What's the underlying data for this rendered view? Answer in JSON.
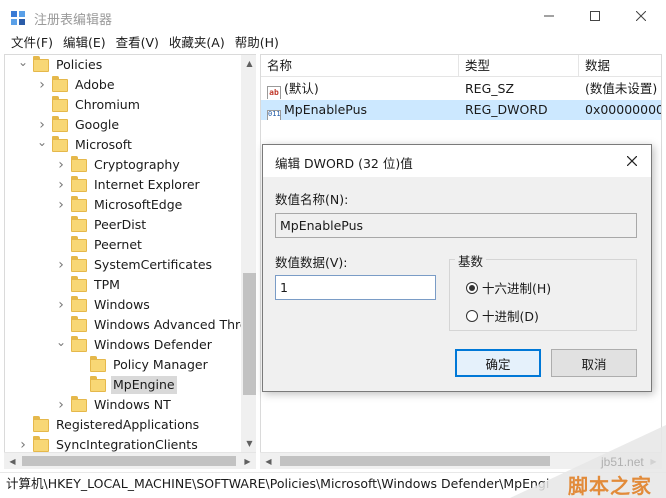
{
  "window": {
    "title": "注册表编辑器",
    "minimize": "—",
    "maximize": "☐",
    "close": "✕"
  },
  "menu": [
    "文件(F)",
    "编辑(E)",
    "查看(V)",
    "收藏夹(A)",
    "帮助(H)"
  ],
  "tree": [
    {
      "label": "Policies",
      "depth": 0,
      "expander": "open"
    },
    {
      "label": "Adobe",
      "depth": 1,
      "expander": "closed"
    },
    {
      "label": "Chromium",
      "depth": 1,
      "expander": "none"
    },
    {
      "label": "Google",
      "depth": 1,
      "expander": "closed"
    },
    {
      "label": "Microsoft",
      "depth": 1,
      "expander": "open"
    },
    {
      "label": "Cryptography",
      "depth": 2,
      "expander": "closed"
    },
    {
      "label": "Internet Explorer",
      "depth": 2,
      "expander": "closed"
    },
    {
      "label": "MicrosoftEdge",
      "depth": 2,
      "expander": "closed"
    },
    {
      "label": "PeerDist",
      "depth": 2,
      "expander": "none"
    },
    {
      "label": "Peernet",
      "depth": 2,
      "expander": "none"
    },
    {
      "label": "SystemCertificates",
      "depth": 2,
      "expander": "closed"
    },
    {
      "label": "TPM",
      "depth": 2,
      "expander": "none"
    },
    {
      "label": "Windows",
      "depth": 2,
      "expander": "closed"
    },
    {
      "label": "Windows Advanced Thre",
      "depth": 2,
      "expander": "none"
    },
    {
      "label": "Windows Defender",
      "depth": 2,
      "expander": "open"
    },
    {
      "label": "Policy Manager",
      "depth": 3,
      "expander": "none"
    },
    {
      "label": "MpEngine",
      "depth": 3,
      "expander": "none",
      "selected": true
    },
    {
      "label": "Windows NT",
      "depth": 2,
      "expander": "closed"
    },
    {
      "label": "RegisteredApplications",
      "depth": 0,
      "expander": "none"
    },
    {
      "label": "SyncIntegrationClients",
      "depth": 0,
      "expander": "closed"
    }
  ],
  "list": {
    "columns": [
      "名称",
      "类型",
      "数据"
    ],
    "rows": [
      {
        "icon": "ab",
        "name": "(默认)",
        "type": "REG_SZ",
        "data": "(数值未设置)",
        "selected": false
      },
      {
        "icon": "011",
        "name": "MpEnablePus",
        "type": "REG_DWORD",
        "data": "0x00000000 (",
        "selected": true
      }
    ]
  },
  "statusbar": "计算机\\HKEY_LOCAL_MACHINE\\SOFTWARE\\Policies\\Microsoft\\Windows Defender\\MpEngi",
  "dialog": {
    "title": "编辑 DWORD (32 位)值",
    "close": "✕",
    "name_label": "数值名称(N):",
    "name_value": "MpEnablePus",
    "data_label": "数值数据(V):",
    "data_value": "1",
    "base_label": "基数",
    "radio_hex": "十六进制(H)",
    "radio_dec": "十进制(D)",
    "selected_base": "hex",
    "ok": "确定",
    "cancel": "取消"
  },
  "watermark": {
    "site": "jb51.net",
    "text": "脚本之家"
  }
}
